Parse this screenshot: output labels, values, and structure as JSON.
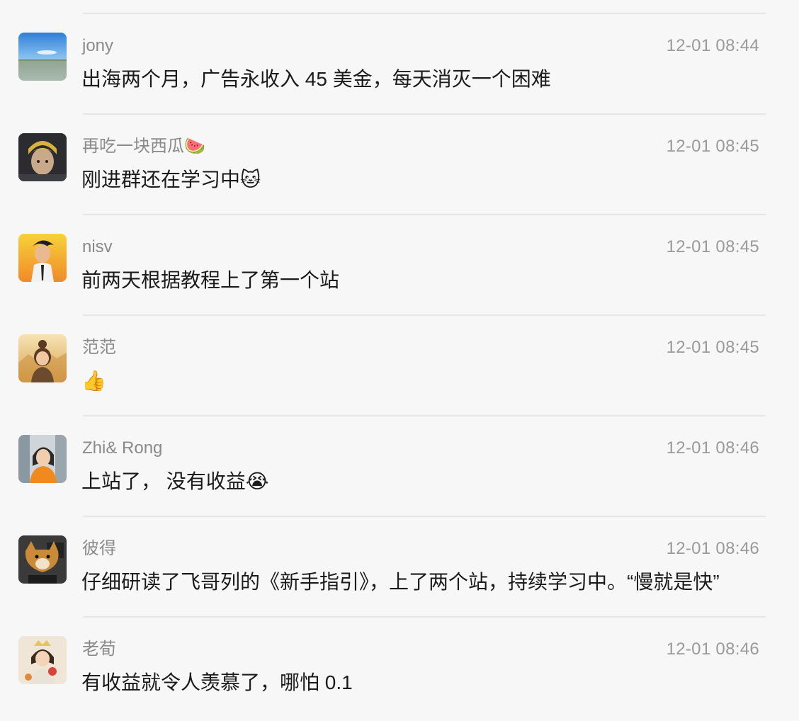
{
  "messages": [
    {
      "sender": "jony",
      "time": "12-01 08:44",
      "text": "出海两个月，广告永收入 45 美金，每天消灭一个困难"
    },
    {
      "sender": "再吃一块西瓜🍉",
      "time": "12-01 08:45",
      "text": "刚进群还在学习中🐱"
    },
    {
      "sender": "nisv",
      "time": "12-01 08:45",
      "text": "前两天根据教程上了第一个站"
    },
    {
      "sender": "范范",
      "time": "12-01 08:45",
      "text": "👍"
    },
    {
      "sender": "Zhi& Rong",
      "time": "12-01 08:46",
      "text": "上站了， 没有收益😭"
    },
    {
      "sender": "彼得",
      "time": "12-01 08:46",
      "text": "仔细研读了飞哥列的《新手指引》，上了两个站，持续学习中。“慢就是快”"
    },
    {
      "sender": "老荀",
      "time": "12-01 08:46",
      "text": "有收益就令人羡慕了，哪怕 0.1"
    }
  ]
}
